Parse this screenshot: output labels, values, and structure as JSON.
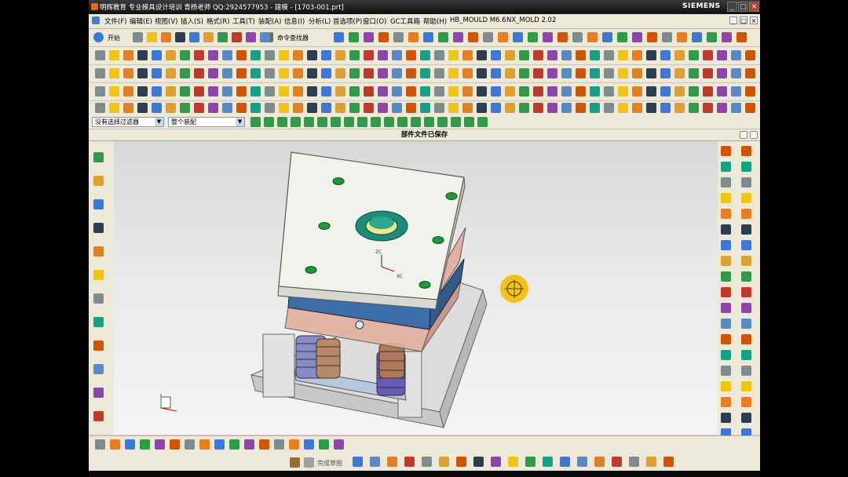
{
  "window": {
    "title": "明辉教育  专业模具设计培训  青杨老师  QQ:2924577953 - 建模 - [1703-001.prt]",
    "brand": "SIEMENS",
    "controls": [
      "_",
      "□",
      "×"
    ]
  },
  "menu": {
    "items": [
      "文件(F)",
      "编辑(E)",
      "视图(V)",
      "插入(S)",
      "格式(R)",
      "工具(T)",
      "装配(A)",
      "信息(I)",
      "分析(L)",
      "首选项(P)",
      "窗口(O)",
      "GC工具箱",
      "帮助(H)",
      "HB_MOULD M6.6",
      "NX_MOLD 2.02"
    ],
    "doc_controls": [
      "_",
      "□",
      "×"
    ]
  },
  "toolbar": {
    "start_label": "开始",
    "command_finder_label": "命令查找器"
  },
  "selection_bar": {
    "filter_value": "没有选择过滤器",
    "scope_value": "整个装配"
  },
  "status": {
    "message": "部件文件已保存"
  },
  "sketch_bar": {
    "finish_label": "完成草图"
  },
  "colors": {
    "title_bg": "#101010",
    "menu_bg": "#ece9d8",
    "plate_top": "#f2f2ec",
    "plate_blue": "#3c6fa8",
    "plate_copper": "#d99a82",
    "spring_purple": "#5a4a9a",
    "spring_bronze": "#b07858",
    "bolt_green": "#1e9a3a",
    "locating_ring": "#1e8a7a",
    "cursor_yellow": "#f0c419"
  }
}
